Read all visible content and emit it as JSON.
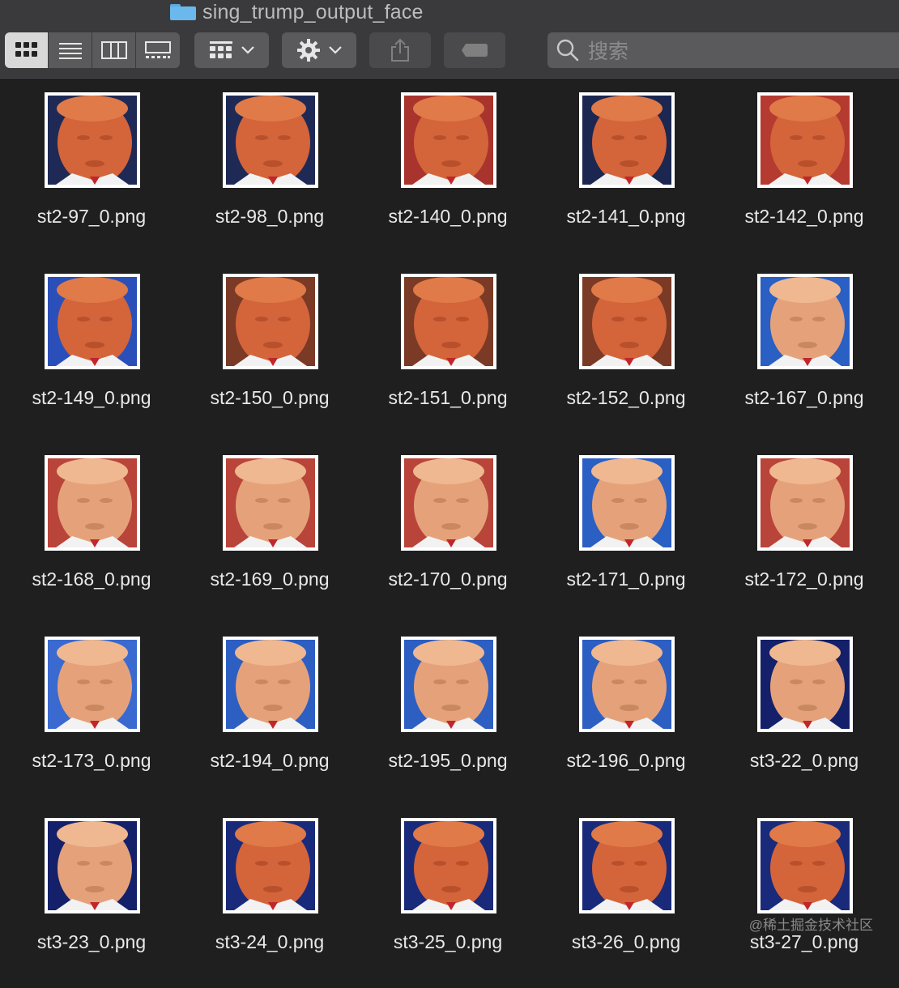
{
  "window": {
    "title": "sing_trump_output_face"
  },
  "toolbar": {
    "view_modes": [
      {
        "name": "icon-view",
        "icon": "grid-icon",
        "active": true
      },
      {
        "name": "list-view",
        "icon": "list-icon",
        "active": false
      },
      {
        "name": "column-view",
        "icon": "columns-icon",
        "active": false
      },
      {
        "name": "gallery-view",
        "icon": "gallery-icon",
        "active": false
      }
    ],
    "group_menu": {
      "icon": "group-grid-icon"
    },
    "action_menu": {
      "icon": "gear-icon"
    },
    "share": {
      "icon": "share-icon"
    },
    "tags": {
      "icon": "tag-icon"
    },
    "search": {
      "placeholder": "搜索"
    }
  },
  "files": [
    {
      "name": "st2-97_0.png",
      "tone": "warm",
      "bg": "#1e2a55"
    },
    {
      "name": "st2-98_0.png",
      "tone": "warm",
      "bg": "#1e2a55"
    },
    {
      "name": "st2-140_0.png",
      "tone": "warm",
      "bg": "#a8342d"
    },
    {
      "name": "st2-141_0.png",
      "tone": "warm",
      "bg": "#1b2750"
    },
    {
      "name": "st2-142_0.png",
      "tone": "warm",
      "bg": "#b53a30"
    },
    {
      "name": "st2-149_0.png",
      "tone": "warm",
      "bg": "#2b4fb8"
    },
    {
      "name": "st2-150_0.png",
      "tone": "warm",
      "bg": "#7a3a25"
    },
    {
      "name": "st2-151_0.png",
      "tone": "warm",
      "bg": "#7a3a25"
    },
    {
      "name": "st2-152_0.png",
      "tone": "warm",
      "bg": "#7a3a25"
    },
    {
      "name": "st2-167_0.png",
      "tone": "pale",
      "bg": "#2a5fc4"
    },
    {
      "name": "st2-168_0.png",
      "tone": "pale",
      "bg": "#b9443a"
    },
    {
      "name": "st2-169_0.png",
      "tone": "pale",
      "bg": "#b9443a"
    },
    {
      "name": "st2-170_0.png",
      "tone": "pale",
      "bg": "#b9443a"
    },
    {
      "name": "st2-171_0.png",
      "tone": "pale",
      "bg": "#2a5fc4"
    },
    {
      "name": "st2-172_0.png",
      "tone": "pale",
      "bg": "#b9443a"
    },
    {
      "name": "st2-173_0.png",
      "tone": "pale",
      "bg": "#3a6ad0"
    },
    {
      "name": "st2-194_0.png",
      "tone": "pale",
      "bg": "#2d5ec2"
    },
    {
      "name": "st2-195_0.png",
      "tone": "pale",
      "bg": "#2d5ec2"
    },
    {
      "name": "st2-196_0.png",
      "tone": "pale",
      "bg": "#2d5ec2"
    },
    {
      "name": "st3-22_0.png",
      "tone": "pale",
      "bg": "#14206a"
    },
    {
      "name": "st3-23_0.png",
      "tone": "pale",
      "bg": "#14206a"
    },
    {
      "name": "st3-24_0.png",
      "tone": "warm",
      "bg": "#1a2a7a"
    },
    {
      "name": "st3-25_0.png",
      "tone": "warm",
      "bg": "#1a2a7a"
    },
    {
      "name": "st3-26_0.png",
      "tone": "warm",
      "bg": "#1a2a7a"
    },
    {
      "name": "st3-27_0.png",
      "tone": "warm",
      "bg": "#1a2a7a"
    }
  ],
  "watermark": "@稀土掘金技术社区"
}
